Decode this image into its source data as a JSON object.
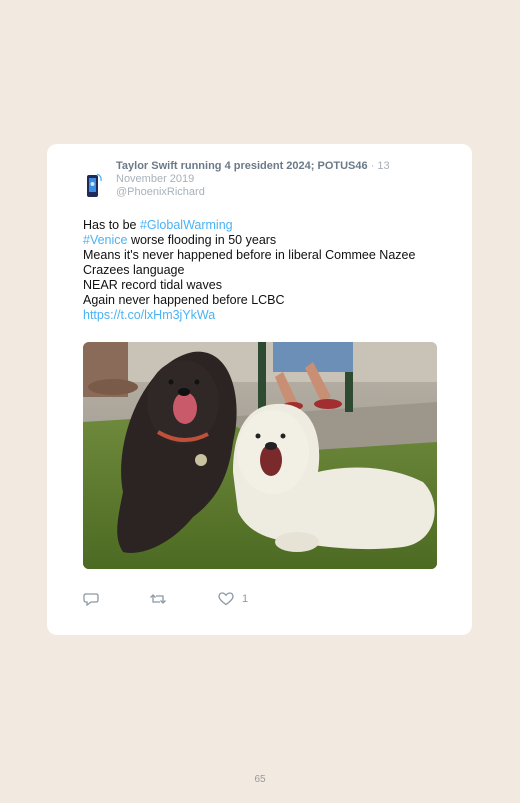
{
  "tweet": {
    "display_name": "Taylor Swift running 4 president 2024; POTUS46",
    "date": " · 13 November 2019",
    "handle": "@PhoenixRichard",
    "lines": [
      {
        "prefix": "Has to be ",
        "link": "#GlobalWarming",
        "suffix": ""
      },
      {
        "prefix": "",
        "link": "#Venice",
        "suffix": " worse flooding in 50 years"
      },
      {
        "prefix": "Means it's never happened before in liberal Commee Nazee",
        "link": "",
        "suffix": ""
      },
      {
        "prefix": "Crazees language",
        "link": "",
        "suffix": ""
      },
      {
        "prefix": "NEAR record tidal waves",
        "link": "",
        "suffix": ""
      },
      {
        "prefix": "Again never happened before LCBC",
        "link": "",
        "suffix": ""
      },
      {
        "prefix": "",
        "link": "https://t.co/lxHm3jYkWa",
        "suffix": ""
      }
    ],
    "likes_count": "1"
  },
  "icons": {
    "avatar": "phone-avatar-icon",
    "reply": "reply-icon",
    "retweet": "retweet-icon",
    "like": "heart-icon"
  },
  "colors": {
    "background": "#f2e9e1",
    "card": "#ffffff",
    "link": "#4ab3f4",
    "muted": "#8b98a5"
  },
  "page_number": "65"
}
